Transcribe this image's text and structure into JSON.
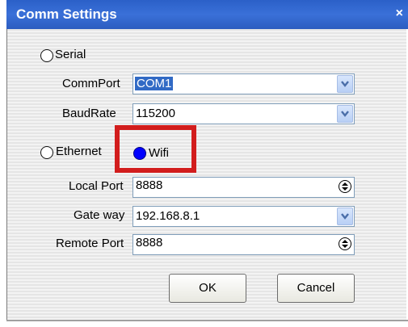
{
  "window": {
    "title": "Comm Settings",
    "close_glyph": "×"
  },
  "serial": {
    "radio_label": "Serial",
    "commport": {
      "label": "CommPort",
      "value": "COM1"
    },
    "baudrate": {
      "label": "BaudRate",
      "value": "115200"
    }
  },
  "network": {
    "ethernet_label": "Ethernet",
    "wifi_label": "Wifi",
    "selected": "Wifi",
    "local_port": {
      "label": "Local Port",
      "value": "8888"
    },
    "gateway": {
      "label": "Gate way",
      "value": "192.168.8.1"
    },
    "remote_port": {
      "label": "Remote Port",
      "value": "8888"
    }
  },
  "buttons": {
    "ok": "OK",
    "cancel": "Cancel"
  },
  "colors": {
    "titlebar": "#2b60c8",
    "selected_radio": "#0000ff",
    "highlight_box": "#d21d1d",
    "selection": "#316ac5"
  }
}
